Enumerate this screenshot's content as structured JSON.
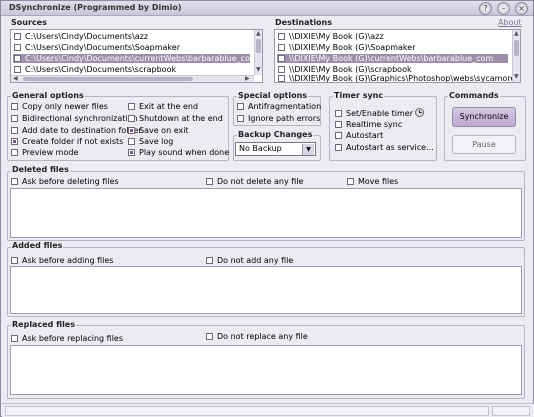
{
  "window": {
    "title": "DSynchronize (Programmed by Dimio)"
  },
  "sources": {
    "title": "Sources",
    "items": [
      {
        "label": "C:\\Users\\Cindy\\Documents\\azz",
        "checked": false,
        "selected": false
      },
      {
        "label": "C:\\Users\\Cindy\\Documents\\Soapmaker",
        "checked": false,
        "selected": false
      },
      {
        "label": "C:\\Users\\Cindy\\Documents\\currentWebs\\barbarablue_com",
        "checked": false,
        "selected": true
      },
      {
        "label": "C:\\Users\\Cindy\\Documents\\scrapbook",
        "checked": false,
        "selected": false
      }
    ]
  },
  "destinations": {
    "title": "Destinations",
    "about": "About",
    "items": [
      {
        "label": "\\\\DIXIE\\My Book (G)\\azz",
        "checked": false,
        "selected": false
      },
      {
        "label": "\\\\DIXIE\\My Book (G)\\Soapmaker",
        "checked": false,
        "selected": false
      },
      {
        "label": "\\\\DIXIE\\My Book (G)\\currentWebs\\barbarablue_com",
        "checked": false,
        "selected": true
      },
      {
        "label": "\\\\DIXIE\\My Book (G)\\scrapbook",
        "checked": false,
        "selected": false
      },
      {
        "label": "\\\\DIXIE\\My Book (G)\\Graphics\\Photoshop\\webs\\sycamore_hill",
        "checked": false,
        "selected": false
      }
    ]
  },
  "general_options": {
    "title": "General options",
    "left": [
      {
        "label": "Copy only newer files",
        "checked": false
      },
      {
        "label": "Bidirectional synchronization",
        "checked": false
      },
      {
        "label": "Add date to destination folder",
        "checked": false
      },
      {
        "label": "Create folder if not exists",
        "checked": true
      },
      {
        "label": "Preview mode",
        "checked": false
      }
    ],
    "right": [
      {
        "label": "Exit at the end",
        "checked": false
      },
      {
        "label": "Shutdown at the end",
        "checked": false
      },
      {
        "label": "Save on exit",
        "checked": true
      },
      {
        "label": "Save log",
        "checked": false
      },
      {
        "label": "Play sound when done",
        "checked": true
      }
    ]
  },
  "special_options": {
    "title": "Special options",
    "items": [
      {
        "label": "Antifragmentation",
        "checked": false
      },
      {
        "label": "Ignore path errors",
        "checked": false
      }
    ]
  },
  "backup_changes": {
    "title": "Backup Changes",
    "value": "No Backup"
  },
  "timer_sync": {
    "title": "Timer sync",
    "items": [
      {
        "label": "Set/Enable timer",
        "checked": false
      },
      {
        "label": "Realtime sync",
        "checked": false
      },
      {
        "label": "Autostart",
        "checked": false
      },
      {
        "label": "Autostart as service...",
        "checked": false
      }
    ]
  },
  "commands": {
    "title": "Commands",
    "synchronize": "Synchronize",
    "pause": "Pause"
  },
  "deleted_files": {
    "title": "Deleted files",
    "options": [
      {
        "label": "Ask before deleting files",
        "checked": false
      },
      {
        "label": "Do not delete any file",
        "checked": false
      },
      {
        "label": "Move files",
        "checked": false
      }
    ]
  },
  "added_files": {
    "title": "Added files",
    "options": [
      {
        "label": "Ask before adding files",
        "checked": false
      },
      {
        "label": "Do not add any file",
        "checked": false
      }
    ]
  },
  "replaced_files": {
    "title": "Replaced files",
    "options": [
      {
        "label": "Ask before replacing files",
        "checked": false
      },
      {
        "label": "Do not replace any file",
        "checked": false
      }
    ]
  },
  "icons": {
    "title_buttons": [
      "help-icon",
      "minimize-icon",
      "close-icon"
    ],
    "timer": "clock-icon"
  },
  "colors": {
    "selection": "#9d8ea9",
    "accent_button": "#bfa8d1"
  }
}
